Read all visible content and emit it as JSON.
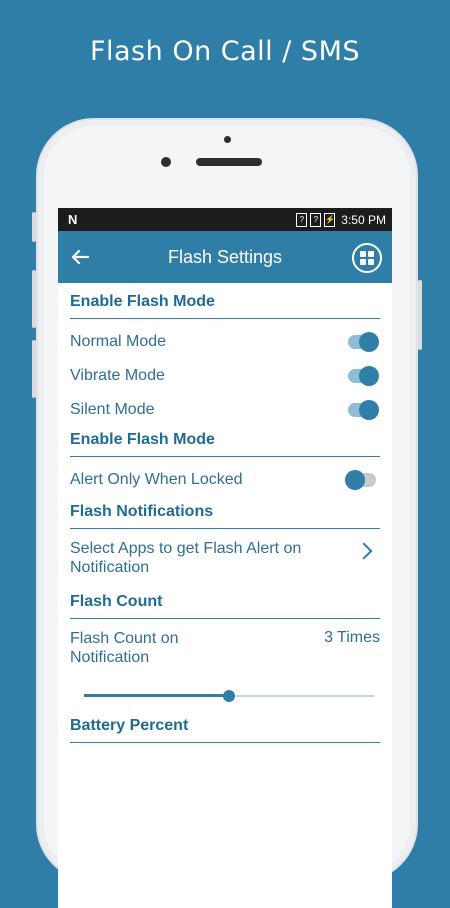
{
  "promo": {
    "title": "Flash On Call / SMS"
  },
  "statusbar": {
    "time": "3:50 PM"
  },
  "appbar": {
    "title": "Flash Settings"
  },
  "sections": {
    "enable_flash_mode_1": "Enable Flash Mode",
    "enable_flash_mode_2": "Enable Flash Mode",
    "flash_notifications": "Flash Notifications",
    "flash_count": "Flash Count",
    "battery_percent": "Battery Percent"
  },
  "modes": [
    {
      "label": "Normal Mode",
      "enabled": true
    },
    {
      "label": "Vibrate Mode",
      "enabled": true
    },
    {
      "label": "Silent Mode",
      "enabled": true
    }
  ],
  "alert_locked": {
    "label": "Alert Only When Locked",
    "enabled": false
  },
  "notifications": {
    "label": "Select Apps to get Flash Alert on Notification"
  },
  "flash_count": {
    "label": "Flash Count on Notification",
    "value": "3",
    "unit": "Times",
    "slider_fraction": 0.5
  },
  "colors": {
    "accent": "#2f7ea7",
    "background": "#2f7ea7"
  },
  "icons": [
    "back-arrow-icon",
    "grid-menu-icon",
    "chevron-right-icon"
  ]
}
